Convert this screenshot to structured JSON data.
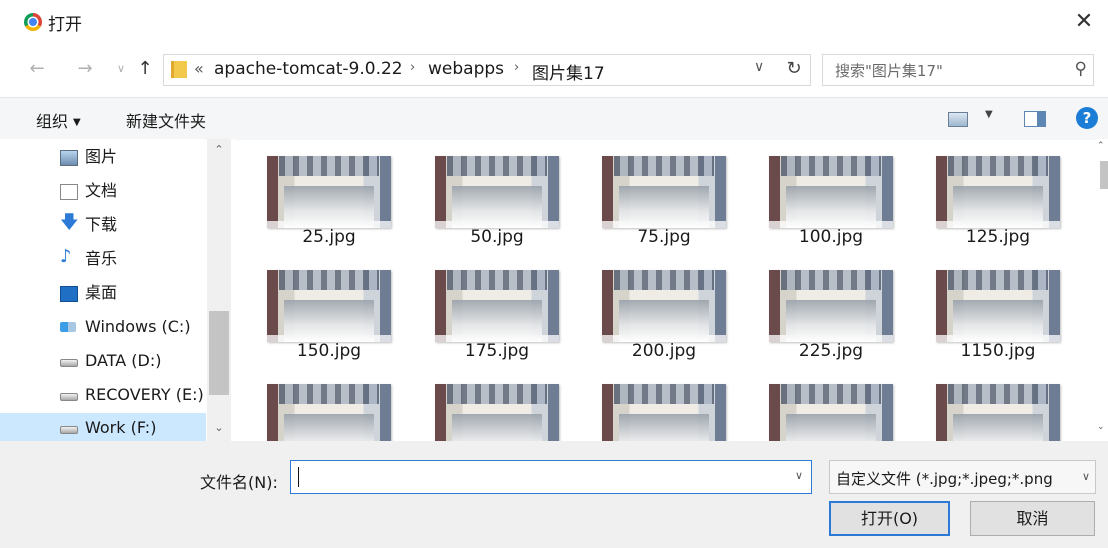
{
  "window": {
    "title": "打开",
    "close_glyph": "✕"
  },
  "nav": {
    "back_glyph": "←",
    "forward_glyph": "→",
    "history_glyph": "∨",
    "up_glyph": "↑",
    "refresh_glyph": "↻",
    "overflow_glyph": "«",
    "separator_glyph": "›",
    "dropdown_glyph": "∨",
    "breadcrumbs": [
      "apache-tomcat-9.0.22",
      "webapps",
      "图片集17"
    ]
  },
  "search": {
    "placeholder": "搜索\"图片集17\"",
    "icon_glyph": "⚲"
  },
  "toolbar": {
    "organize_label": "组织",
    "organize_arrow": "▼",
    "new_folder_label": "新建文件夹",
    "view_dropdown_glyph": "▼",
    "help_glyph": "?"
  },
  "sidebar": {
    "items": [
      {
        "label": "图片",
        "icon": "pictures-icon"
      },
      {
        "label": "文档",
        "icon": "documents-icon"
      },
      {
        "label": "下载",
        "icon": "download-icon",
        "glyph": "🡇"
      },
      {
        "label": "音乐",
        "icon": "music-icon",
        "glyph": "♪"
      },
      {
        "label": "桌面",
        "icon": "desktop-icon"
      },
      {
        "label": "Windows (C:)",
        "icon": "windows-drive-icon"
      },
      {
        "label": "DATA (D:)",
        "icon": "drive-icon"
      },
      {
        "label": "RECOVERY (E:)",
        "icon": "drive-icon"
      },
      {
        "label": "Work (F:)",
        "icon": "drive-icon",
        "selected": true
      }
    ],
    "scroll_up_glyph": "⌃",
    "scroll_down_glyph": "⌄"
  },
  "files": [
    "25.jpg",
    "50.jpg",
    "75.jpg",
    "100.jpg",
    "125.jpg",
    "150.jpg",
    "175.jpg",
    "200.jpg",
    "225.jpg",
    "1150.jpg",
    "",
    "",
    "",
    "",
    ""
  ],
  "footer": {
    "filename_label": "文件名(N):",
    "filename_value": "",
    "filename_dropdown_glyph": "∨",
    "filter_label": "自定义文件 (*.jpg;*.jpeg;*.png",
    "filter_dropdown_glyph": "∨",
    "open_label": "打开(O)",
    "cancel_label": "取消"
  },
  "colors": {
    "selection": "#cce8ff",
    "accent": "#2c7ad6",
    "help": "#1c7dd6",
    "folder": "#f2c94c"
  }
}
